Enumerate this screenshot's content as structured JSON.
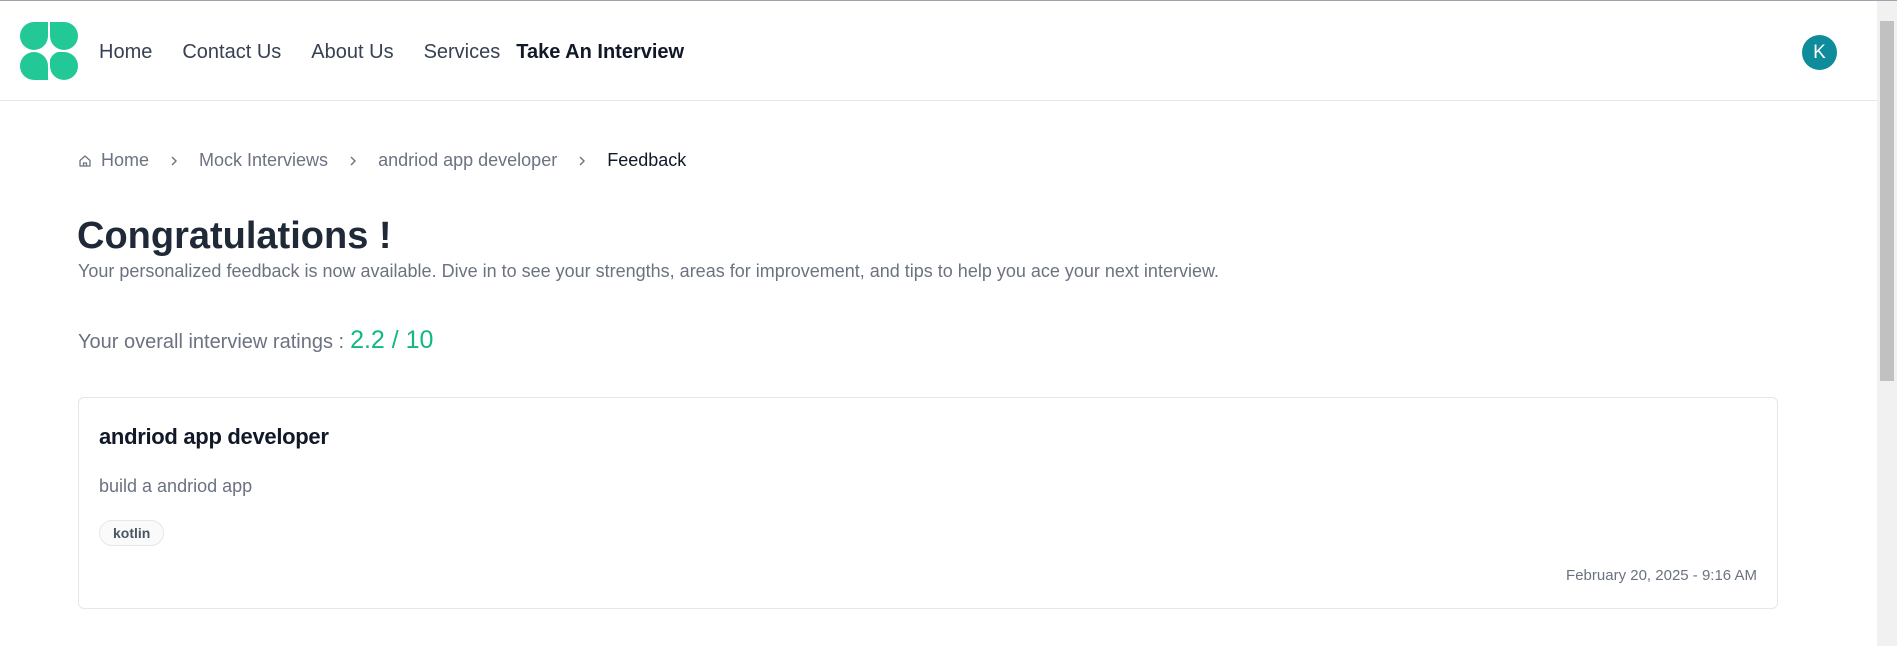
{
  "header": {
    "nav": [
      {
        "label": "Home"
      },
      {
        "label": "Contact Us"
      },
      {
        "label": "About Us"
      },
      {
        "label": "Services"
      },
      {
        "label": "Take An Interview"
      }
    ],
    "avatar_initial": "K",
    "logo_icon": "four-petal-logo-icon",
    "accent_color": "#22c997"
  },
  "breadcrumb": {
    "items": [
      {
        "label": "Home",
        "icon": "home-icon"
      },
      {
        "label": "Mock Interviews"
      },
      {
        "label": "andriod app developer"
      },
      {
        "label": "Feedback"
      }
    ],
    "separator_icon": "chevron-right-icon"
  },
  "main": {
    "title": "Congratulations !",
    "subtitle": "Your personalized feedback is now available. Dive in to see your strengths, areas for improvement, and tips to help you ace your next interview.",
    "rating_label": "Your overall interview ratings :",
    "rating_value": "2.2 / 10",
    "rating_color": "#10b981"
  },
  "card": {
    "title": "andriod app developer",
    "description": "build a andriod app",
    "tags": [
      "kotlin"
    ],
    "date": "February 20, 2025 - 9:16 AM"
  }
}
